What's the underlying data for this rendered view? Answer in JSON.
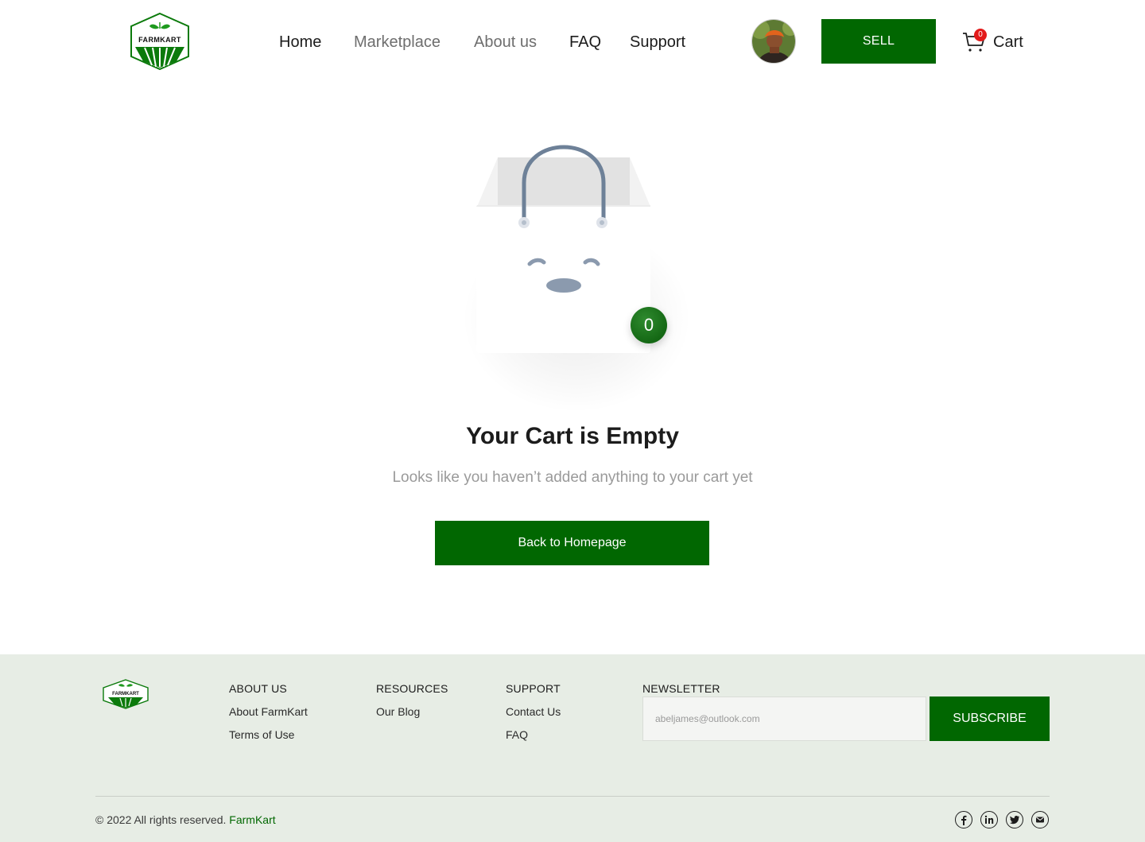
{
  "brand": {
    "logo_text": "FARMKART",
    "colors": {
      "primary": "#016701",
      "badge_red": "#e31b1b",
      "footer_bg": "#e7ede5"
    }
  },
  "nav": {
    "items": [
      {
        "label": "Home",
        "state": "active"
      },
      {
        "label": "Marketplace",
        "state": "muted"
      },
      {
        "label": "About us",
        "state": "muted"
      },
      {
        "label": "FAQ",
        "state": "normal"
      },
      {
        "label": "Support",
        "state": "normal"
      }
    ]
  },
  "header": {
    "avatar_icon": "user-avatar",
    "sell_label": "SELL",
    "cart": {
      "label": "Cart",
      "count": "0",
      "icon": "cart-icon"
    }
  },
  "empty_state": {
    "illustration_icon": "shopping-bag-icon",
    "badge_count": "0",
    "title": "Your Cart is Empty",
    "subtitle": "Looks like you haven’t added anything to your cart yet",
    "button_label": "Back to Homepage"
  },
  "footer": {
    "columns": [
      {
        "heading": "ABOUT US",
        "links": [
          "About FarmKart",
          "Terms of Use"
        ]
      },
      {
        "heading": "RESOURCES",
        "links": [
          "Our Blog"
        ]
      },
      {
        "heading": "SUPPORT",
        "links": [
          "Contact Us",
          "FAQ"
        ]
      }
    ],
    "newsletter": {
      "heading": "NEWSLETTER",
      "placeholder": "abeljames@outlook.com",
      "button_label": "SUBSCRIBE"
    },
    "copyright_prefix": "© 2022 All rights reserved.",
    "copyright_brand": "FarmKart",
    "socials": [
      "facebook-icon",
      "linkedin-icon",
      "twitter-icon",
      "mail-icon"
    ]
  }
}
